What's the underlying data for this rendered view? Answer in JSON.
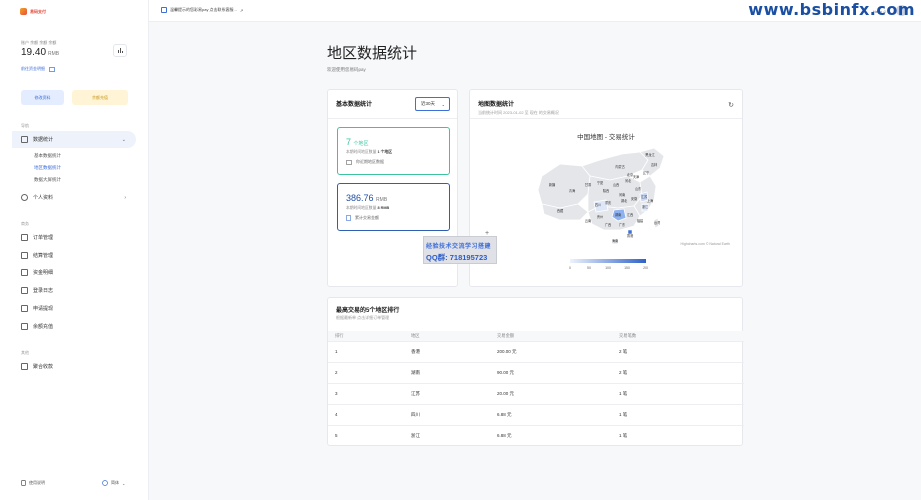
{
  "app": {
    "logo_text": "易码支付"
  },
  "sidebar": {
    "balance_label": "账户 余额 余额 余额",
    "balance_value": "19.40",
    "balance_unit": "RMB",
    "details_link": "前往资金明细",
    "edit_btn": "修改资料",
    "recharge_btn": "余额充值",
    "section_nav": "导航",
    "nav_data": "数据统计",
    "sub_items": [
      "基本数据统计",
      "地区数据统计",
      "数据大屏统计"
    ],
    "nav_profile": "个人资料",
    "section_business": "商务",
    "business_items": [
      "订单管理",
      "结算管理",
      "资金明细",
      "登录日志",
      "申请提现",
      "余额充值"
    ],
    "section_other": "其他",
    "other_items": [
      "聚合收款"
    ],
    "footer_left": "使用说明",
    "footer_right": "简体"
  },
  "topbar": {
    "message": "温馨提示的您彩易pay 点击联系客服...",
    "user": "Hello ☺",
    "watermark": "www.bsbinfx.com"
  },
  "page": {
    "title": "地区数据统计",
    "subtitle": "欢迎使用您易码pay"
  },
  "basic_card": {
    "title": "基本数据统计",
    "range": "近30天",
    "stat1_value": "7",
    "stat1_unit": "个地区",
    "stat1_desc_prefix": "本期时间地区数量",
    "stat1_desc_value": "1 个地区",
    "stat1_link": "你近期地区数据",
    "stat2_value": "386.76",
    "stat2_unit": "RMB",
    "stat2_desc_prefix": "本期时间地区数量",
    "stat2_desc_value": "8 RMB",
    "stat2_link": "累计交易金额"
  },
  "map_card": {
    "title": "地图数据统计",
    "subtitle": "当前统计时间 2023-01-02 至 现在 的交易概况",
    "chart_title": "中国地图 - 交易统计",
    "credit": "Highcharts.com © Natural Earth"
  },
  "chart_data": {
    "type": "heatmap",
    "title": "中国地图 - 交易统计",
    "color_scale": {
      "min": 0,
      "max": 200,
      "ticks": [
        0,
        50,
        100,
        150,
        200
      ]
    },
    "region_labels": [
      "新疆",
      "西藏",
      "青海",
      "甘肃",
      "内蒙古",
      "黑龙江",
      "吉林",
      "辽宁",
      "宁夏",
      "陕西",
      "山西",
      "河北",
      "北京",
      "天津",
      "山东",
      "河南",
      "四川",
      "重庆",
      "湖北",
      "安徽",
      "江苏",
      "上海",
      "浙江",
      "湖南",
      "江西",
      "贵州",
      "云南",
      "广西",
      "广东",
      "福建",
      "台湾",
      "海南",
      "香港"
    ]
  },
  "overlay": {
    "line1": "经验技术交流学习搭建",
    "line2": "QQ群: 718195723"
  },
  "rank_card": {
    "title": "最高交易的5个地区排行",
    "subtitle": "根据最新单 点击详细订单管理",
    "columns": [
      "排行",
      "地区",
      "交易金额",
      "交易笔数"
    ],
    "rows": [
      [
        "1",
        "香港",
        "200.00 元",
        "2 笔"
      ],
      [
        "2",
        "湖南",
        "90.00 元",
        "2 笔"
      ],
      [
        "3",
        "江苏",
        "20.00 元",
        "1 笔"
      ],
      [
        "4",
        "四川",
        "6.88 元",
        "1 笔"
      ],
      [
        "5",
        "浙江",
        "6.88 元",
        "1 笔"
      ]
    ]
  }
}
